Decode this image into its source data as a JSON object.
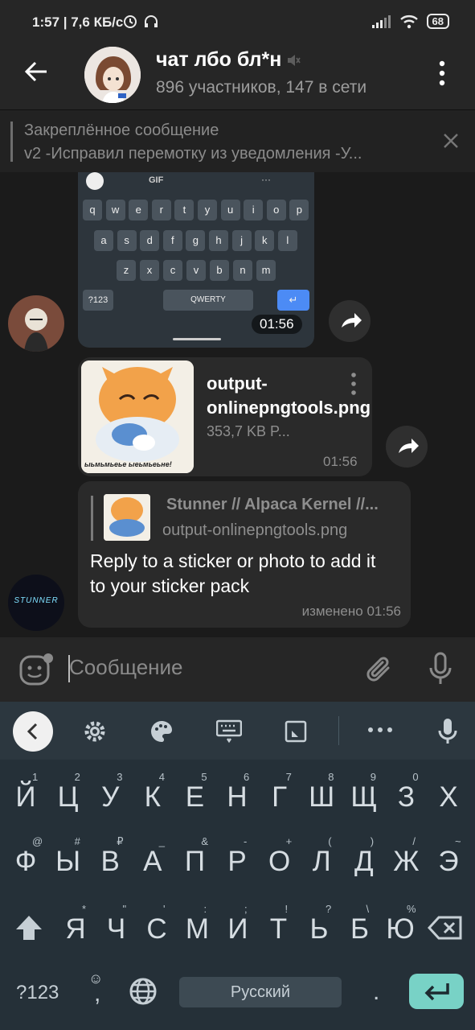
{
  "status_bar": {
    "time_speed": "1:57 | 7,6 КБ/с",
    "battery": "68"
  },
  "header": {
    "title": "чат лбо бл*н",
    "subtitle": "896 участников, 147 в сети"
  },
  "pinned": {
    "title": "Закреплённое сообщение",
    "text": "v2  -Исправил перемотку из уведомления -У..."
  },
  "messages": {
    "keyboard_screenshot": {
      "time": "01:56",
      "mini_keys": {
        "toolbar": [
          "GIF",
          "···"
        ],
        "row1": [
          "q",
          "w",
          "e",
          "r",
          "t",
          "y",
          "u",
          "i",
          "o",
          "p"
        ],
        "row2": [
          "a",
          "s",
          "d",
          "f",
          "g",
          "h",
          "j",
          "k",
          "l"
        ],
        "row3": [
          "z",
          "x",
          "c",
          "v",
          "b",
          "n",
          "m"
        ],
        "sym": "?123",
        "space": "QWERTY"
      }
    },
    "file": {
      "name": "output-onlinepngtools.png",
      "size": "353,7 KB P...",
      "time": "01:56",
      "sticker_caption": "ыьмьмьеье ыеьмьеьне!"
    },
    "reply": {
      "reply_author": "Stunner // Alpaca Kernel //...",
      "reply_file": "output-onlinepngtools.png",
      "text": "Reply to a sticker or photo to add it to your sticker pack",
      "time": "изменено 01:56",
      "avatar_text": "STUNNER"
    }
  },
  "input": {
    "placeholder": "Сообщение"
  },
  "keyboard": {
    "row1": [
      "Й",
      "Ц",
      "У",
      "К",
      "Е",
      "Н",
      "Г",
      "Ш",
      "Щ",
      "З",
      "Х"
    ],
    "row1_hints": [
      "1",
      "2",
      "3",
      "4",
      "5",
      "6",
      "7",
      "8",
      "9",
      "0",
      ""
    ],
    "row2": [
      "Ф",
      "Ы",
      "В",
      "А",
      "П",
      "Р",
      "О",
      "Л",
      "Д",
      "Ж",
      "Э"
    ],
    "row2_hints": [
      "@",
      "#",
      "₽",
      "_",
      "&",
      "-",
      "+",
      "(",
      ")",
      "/",
      "~"
    ],
    "row3": [
      "Я",
      "Ч",
      "С",
      "М",
      "И",
      "Т",
      "Ь",
      "Б",
      "Ю"
    ],
    "row3_hints": [
      "*",
      "\"",
      "'",
      ":",
      ";",
      "!",
      "?",
      "\\",
      "%"
    ],
    "sym_label": "?123",
    "comma": ",",
    "space_label": "Русский",
    "period": "."
  },
  "colors": {
    "accent_enter": "#78d2c6",
    "keyboard_bg": "#253038"
  }
}
